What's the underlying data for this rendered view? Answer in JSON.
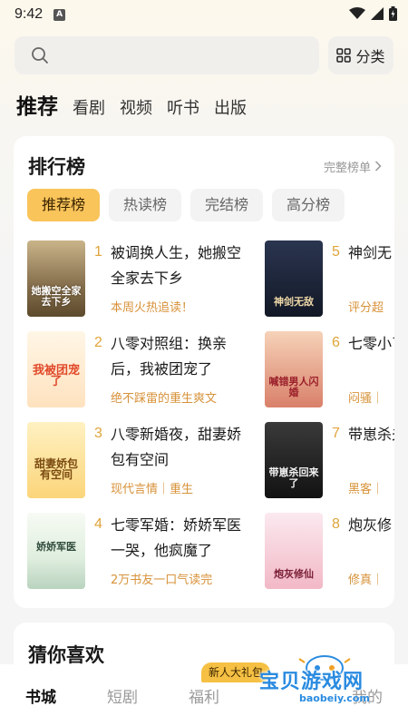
{
  "status": {
    "time": "9:42",
    "notify_letter": "A"
  },
  "search": {
    "placeholder": "",
    "category_label": "分类"
  },
  "top_tabs": [
    "推荐",
    "看剧",
    "视频",
    "听书",
    "出版"
  ],
  "ranking": {
    "title": "排行榜",
    "more_label": "完整榜单",
    "tabs": [
      "推荐榜",
      "热读榜",
      "完结榜",
      "高分榜"
    ],
    "books": [
      {
        "num": "1",
        "title": "被调换人生，她搬空全家去下乡",
        "tag": "本周火热追读！",
        "cover_text": "她搬空全家去下乡"
      },
      {
        "num": "2",
        "title": "八零对照组：换亲后，我被团宠了",
        "tag": "绝不踩雷的重生爽文",
        "cover_text": "我被团宠了"
      },
      {
        "num": "3",
        "title": "八零新婚夜，甜妻娇包有空间",
        "tag": "现代言情｜重生",
        "cover_text": "甜妻娇包有空间"
      },
      {
        "num": "4",
        "title": "七零军婚：娇娇军医一哭，他疯魔了",
        "tag": "2万书友一口气读完",
        "cover_text": "娇娇军医"
      },
      {
        "num": "5",
        "title": "神剑无",
        "tag": "评分超",
        "cover_text": "神剑无敌"
      },
      {
        "num": "6",
        "title": "七零小了，啊",
        "tag": "闷骚｜",
        "cover_text": "喊错男人闪婚"
      },
      {
        "num": "7",
        "title": "带崽杀夫每天",
        "tag": "黑客｜",
        "cover_text": "带崽杀回来了"
      },
      {
        "num": "8",
        "title": "炮灰修",
        "tag": "修真｜",
        "cover_text": "炮灰修仙"
      }
    ]
  },
  "guess": {
    "title": "猜你喜欢"
  },
  "bottom_nav": [
    "书城",
    "短剧",
    "福利",
    "",
    "我的"
  ],
  "promo_badge": "新人大礼包",
  "watermark": {
    "text": "宝贝游戏网",
    "url": "baobeiy.com"
  },
  "colors": {
    "accent": "#f9c45a",
    "tag": "#d7923a",
    "rank_num": "#e0a43a"
  }
}
